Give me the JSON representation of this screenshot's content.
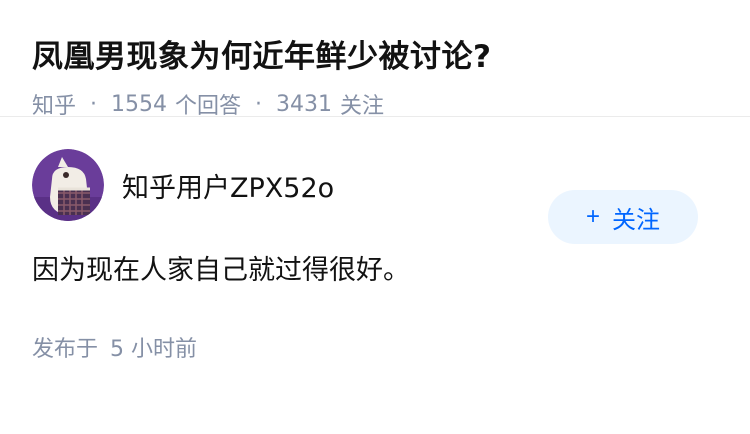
{
  "question": {
    "title": "凤凰男现象为何近年鲜少被讨论?",
    "source": "知乎",
    "answer_count": "1554",
    "answer_label": "个回答",
    "follower_count": "3431",
    "follower_label": "关注",
    "separator": "·"
  },
  "answer": {
    "author_name": "知乎用户ZPX52o",
    "avatar_icon": "user-avatar-icon",
    "follow_plus": "+",
    "follow_label": "关注",
    "content": "因为现在人家自己就过得很好。",
    "published_prefix": "发布于",
    "published_time": "5 小时前"
  },
  "colors": {
    "meta": "#8590a6",
    "accent": "#0066ff",
    "follow_bg": "#ebf5ff",
    "avatar_bg": "#6a3d9a"
  }
}
